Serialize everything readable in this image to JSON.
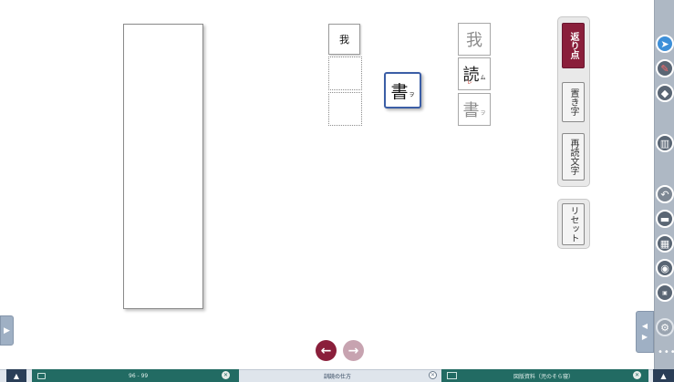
{
  "exercise": {
    "source_char": "我",
    "drag_tile": {
      "char": "書",
      "kana": "ヲ"
    },
    "reference": [
      {
        "char": "我",
        "kana": ""
      },
      {
        "char": "読",
        "kana": "ム",
        "mark": "レ"
      },
      {
        "char": "書",
        "kana": "ヲ"
      }
    ]
  },
  "tools": {
    "kaeriten": "返り点",
    "okiji": "置き字",
    "saidoku": "再読文字",
    "reset": "リセット"
  },
  "navigation": {
    "prev_icon": "←",
    "next_icon": "→"
  },
  "rail_icons": [
    "pointer-icon",
    "pen-icon",
    "eraser-icon",
    "book-icon",
    "undo-icon",
    "minus-icon",
    "gallery-icon",
    "camera-icon",
    "zoom-icon",
    "settings-icon"
  ],
  "bottom_bar": {
    "tab1": {
      "pages": "96 - 99",
      "close": "✕"
    },
    "middle": {
      "label": "訓読の仕方",
      "close": "✕"
    },
    "tab2": {
      "label": "図版資料（児のそら寝）",
      "close": "✕"
    },
    "up_arrow": "▲"
  },
  "colors": {
    "accent": "#8a1f3b",
    "tab": "#226b63",
    "rail": "#aeb8c4",
    "tile_border": "#3b5ea6"
  }
}
